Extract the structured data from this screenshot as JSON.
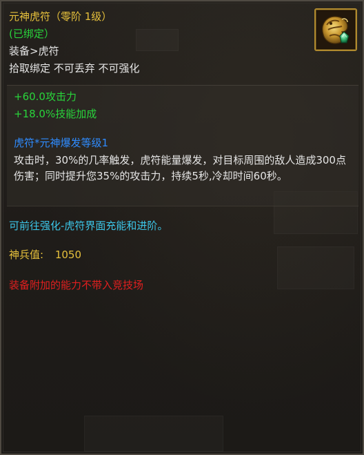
{
  "item": {
    "name": "元神虎符（零阶 1级）",
    "bind_status": "(已绑定）",
    "category": "装备>虎符",
    "restrictions": "拾取绑定 不可丢弃 不可强化",
    "icon": "tiger-talisman-icon"
  },
  "stats": [
    "+60.0攻击力",
    "+18.0%技能加成"
  ],
  "skill": {
    "name": "虎符*元神爆发等级1",
    "description": "攻击时，30%的几率触发，虎符能量爆发，对目标周围的敌人造成300点伤害；同时提升您35%的攻击力，持续5秒,冷却时间60秒。"
  },
  "upgrade_hint": "可前往强化-虎符界面充能和进阶。",
  "divine_value": {
    "label": "神兵值:",
    "value": "1050"
  },
  "arena_note": "装备附加的能力不带入竞技场",
  "colors": {
    "gold": "#e7c13c",
    "green": "#29d43b",
    "blue": "#2f8cff",
    "cyan": "#3cc6e8",
    "red": "#e21f1f"
  }
}
